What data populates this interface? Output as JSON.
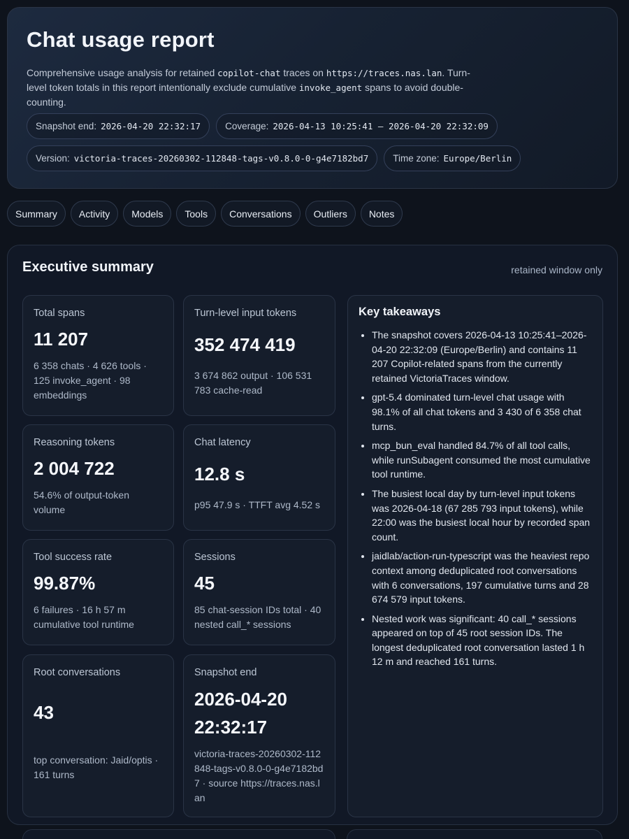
{
  "header": {
    "title": "Chat usage report",
    "desc_1": "Comprehensive usage analysis for retained ",
    "desc_code_1": "copilot-chat",
    "desc_2": " traces on ",
    "desc_code_2": "https://traces.nas.lan",
    "desc_3": ". Turn-level token totals in this report intentionally exclude cumulative ",
    "desc_code_3": "invoke_agent",
    "desc_4": " spans to avoid double-counting.",
    "chips": [
      {
        "label": "Snapshot end:",
        "value": "2026-04-20 22:32:17"
      },
      {
        "label": "Coverage:",
        "value": "2026-04-13 10:25:41 – 2026-04-20 22:32:09"
      },
      {
        "label": "Version:",
        "value": "victoria-traces-20260302-112848-tags-v0.8.0-0-g4e7182bd7"
      },
      {
        "label": "Time zone:",
        "value": "Europe/Berlin"
      }
    ]
  },
  "tabs": [
    "Summary",
    "Activity",
    "Models",
    "Tools",
    "Conversations",
    "Outliers",
    "Notes"
  ],
  "summary": {
    "title": "Executive summary",
    "note": "retained window only",
    "cards": [
      {
        "label": "Total spans",
        "value": "11 207",
        "sub": "6 358 chats · 4 626 tools · 125 invoke_agent · 98 embeddings"
      },
      {
        "label": "Turn-level input tokens",
        "value": "352 474 419",
        "sub": "3 674 862 output · 106 531 783 cache-read"
      },
      {
        "label": "Reasoning tokens",
        "value": "2 004 722",
        "sub": "54.6% of output-token volume"
      },
      {
        "label": "Chat latency",
        "value": "12.8 s",
        "sub": "p95 47.9 s · TTFT avg 4.52 s"
      },
      {
        "label": "Tool success rate",
        "value": "99.87%",
        "sub": "6 failures · 16 h 57 m cumulative tool runtime"
      },
      {
        "label": "Sessions",
        "value": "45",
        "sub": "85 chat-session IDs total · 40 nested call_* sessions"
      },
      {
        "label": "Root conversations",
        "value": "43",
        "sub": "top conversation: Jaid/optis · 161 turns"
      },
      {
        "label": "Snapshot end",
        "value": "2026-04-20 22:32:17",
        "sub": "victoria-traces-20260302-112848-tags-v0.8.0-0-g4e7182bd7 · source https://traces.nas.lan"
      }
    ],
    "takeaways_title": "Key takeaways",
    "takeaways": [
      "The snapshot covers 2026-04-13 10:25:41–2026-04-20 22:32:09 (Europe/Berlin) and contains 11 207 Copilot-related spans from the currently retained VictoriaTraces window.",
      "gpt-5.4 dominated turn-level chat usage with 98.1% of all chat tokens and 3 430 of 6 358 chat turns.",
      "mcp_bun_eval handled 84.7% of all tool calls, while runSubagent consumed the most cumulative tool runtime.",
      "The busiest local day by turn-level input tokens was 2026-04-18 (67 285 793 input tokens), while 22:00 was the busiest local hour by recorded span count.",
      "jaidlab/action-run-typescript was the heaviest repo context among deduplicated root conversations with 6 conversations, 197 cumulative turns and 28 674 579 input tokens.",
      "Nested work was significant: 40 call_* sessions appeared on top of 45 root session IDs. The longest deduplicated root conversation lasted 1 h 12 m and reached 161 turns."
    ]
  }
}
